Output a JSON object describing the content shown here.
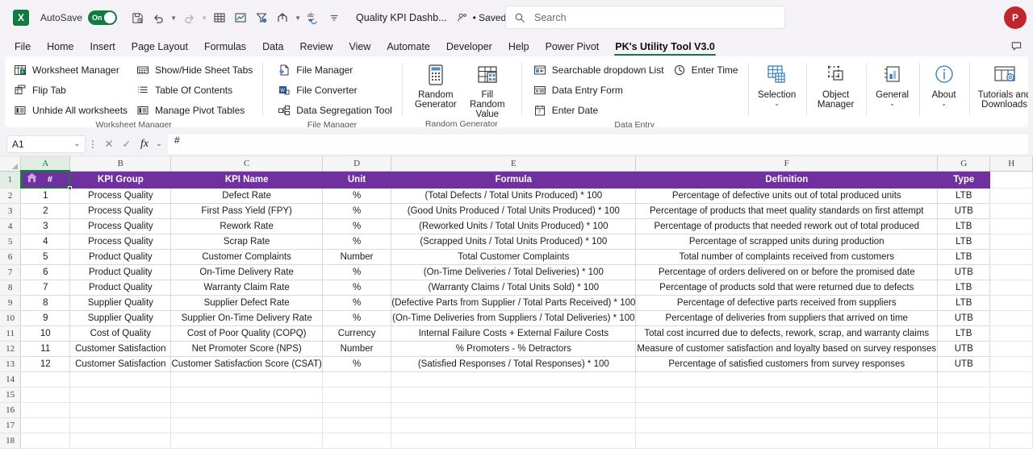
{
  "titlebar": {
    "app_logo_letter": "X",
    "autosave_label": "AutoSave",
    "autosave_state": "On",
    "document_title": "Quality KPI Dashb...",
    "saved_state": "• Saved",
    "quick_access_icons": [
      "save-icon",
      "undo-icon",
      "redo-icon",
      "table-icon",
      "chart-icon",
      "filter-icon",
      "share-icon",
      "spelling-icon",
      "customize-qat-icon"
    ],
    "avatar_initial": "P"
  },
  "search": {
    "placeholder": "Search",
    "value": "",
    "icon": "search-icon"
  },
  "tabs": [
    {
      "label": "File",
      "active": false
    },
    {
      "label": "Home",
      "active": false
    },
    {
      "label": "Insert",
      "active": false
    },
    {
      "label": "Page Layout",
      "active": false
    },
    {
      "label": "Formulas",
      "active": false
    },
    {
      "label": "Data",
      "active": false
    },
    {
      "label": "Review",
      "active": false
    },
    {
      "label": "View",
      "active": false
    },
    {
      "label": "Automate",
      "active": false
    },
    {
      "label": "Developer",
      "active": false
    },
    {
      "label": "Help",
      "active": false
    },
    {
      "label": "Power Pivot",
      "active": false
    },
    {
      "label": "PK's Utility Tool V3.0",
      "active": true
    }
  ],
  "ribbon": {
    "groups": [
      {
        "title": "Worksheet Manager",
        "columns": [
          [
            "Worksheet Manager",
            "Flip Tab",
            "Unhide All worksheets"
          ],
          [
            "Show/Hide Sheet Tabs",
            "Table Of Contents",
            "Manage Pivot Tables"
          ]
        ]
      },
      {
        "title": "File Manager",
        "columns": [
          [
            "File Manager",
            "File Converter",
            "Data Segregation Tool"
          ]
        ]
      },
      {
        "title": "Random Generator",
        "big_buttons": [
          {
            "label": "Random Generator",
            "icon": "calculator-icon",
            "caret": false
          },
          {
            "label": "Fill Random Value",
            "icon": "fill-table-icon",
            "caret": false
          }
        ]
      },
      {
        "title": "Data Entry",
        "columns": [
          [
            "Searchable dropdown List",
            "Data Entry Form",
            "Enter Date"
          ],
          [
            "Enter Time"
          ]
        ]
      },
      {
        "title": "",
        "big_buttons": [
          {
            "label": "Selection",
            "icon": "selection-grid-icon",
            "caret": true
          },
          {
            "label": "Object Manager",
            "icon": "object-manager-icon",
            "caret": true
          },
          {
            "label": "General",
            "icon": "general-chart-icon",
            "caret": true
          },
          {
            "label": "About",
            "icon": "info-icon",
            "caret": true
          },
          {
            "label": "Tutorials and Downloads",
            "icon": "tutorials-gear-icon",
            "caret": true
          }
        ]
      }
    ]
  },
  "formula_bar": {
    "name_box": "A1",
    "cancel_icon": "cancel-icon",
    "confirm_icon": "confirm-icon",
    "fx_label": "fx",
    "content": "#"
  },
  "grid": {
    "column_letters": [
      "A",
      "B",
      "C",
      "D",
      "E",
      "F",
      "G",
      "H"
    ],
    "selected_column": "A",
    "selected_row": 1,
    "row_numbers": [
      1,
      2,
      3,
      4,
      5,
      6,
      7,
      8,
      9,
      10,
      11,
      12,
      13,
      14,
      15,
      16,
      17,
      18
    ],
    "a1_icon": "home-icon",
    "a1_text": "#",
    "header_fill": "#7030A0",
    "headers": [
      "#",
      "KPI Group",
      "KPI Name",
      "Unit",
      "Formula",
      "Definition",
      "Type"
    ],
    "rows": [
      {
        "num": "1",
        "group": "Process Quality",
        "name": "Defect Rate",
        "unit": "%",
        "formula": "(Total Defects / Total Units Produced) * 100",
        "definition": "Percentage of defective units out of total produced units",
        "type": "LTB"
      },
      {
        "num": "2",
        "group": "Process Quality",
        "name": "First Pass Yield (FPY)",
        "unit": "%",
        "formula": "(Good Units Produced / Total Units Produced) * 100",
        "definition": "Percentage of products that meet quality standards on first attempt",
        "type": "UTB"
      },
      {
        "num": "3",
        "group": "Process Quality",
        "name": "Rework Rate",
        "unit": "%",
        "formula": "(Reworked Units / Total Units Produced) * 100",
        "definition": "Percentage of products that needed rework out of total produced",
        "type": "LTB"
      },
      {
        "num": "4",
        "group": "Process Quality",
        "name": "Scrap Rate",
        "unit": "%",
        "formula": "(Scrapped Units / Total Units Produced) * 100",
        "definition": "Percentage of scrapped units during production",
        "type": "LTB"
      },
      {
        "num": "5",
        "group": "Product Quality",
        "name": "Customer Complaints",
        "unit": "Number",
        "formula": "Total Customer Complaints",
        "definition": "Total number of complaints received from customers",
        "type": "LTB"
      },
      {
        "num": "6",
        "group": "Product Quality",
        "name": "On-Time Delivery Rate",
        "unit": "%",
        "formula": "(On-Time Deliveries / Total Deliveries) * 100",
        "definition": "Percentage of orders delivered on or before the promised date",
        "type": "UTB"
      },
      {
        "num": "7",
        "group": "Product Quality",
        "name": "Warranty Claim Rate",
        "unit": "%",
        "formula": "(Warranty Claims / Total Units Sold) * 100",
        "definition": "Percentage of products sold that were returned due to defects",
        "type": "LTB"
      },
      {
        "num": "8",
        "group": "Supplier Quality",
        "name": "Supplier Defect Rate",
        "unit": "%",
        "formula": "(Defective Parts from Supplier / Total Parts Received) * 100",
        "definition": "Percentage of defective parts received from suppliers",
        "type": "LTB"
      },
      {
        "num": "9",
        "group": "Supplier Quality",
        "name": "Supplier On-Time Delivery Rate",
        "unit": "%",
        "formula": "(On-Time Deliveries from Suppliers / Total Deliveries) * 100",
        "definition": "Percentage of deliveries from suppliers that arrived on time",
        "type": "UTB"
      },
      {
        "num": "10",
        "group": "Cost of Quality",
        "name": "Cost of Poor Quality (COPQ)",
        "unit": "Currency",
        "formula": "Internal Failure Costs + External Failure Costs",
        "definition": "Total cost incurred due to defects, rework, scrap, and warranty claims",
        "type": "LTB"
      },
      {
        "num": "11",
        "group": "Customer Satisfaction",
        "name": "Net Promoter Score (NPS)",
        "unit": "Number",
        "formula": "% Promoters - % Detractors",
        "definition": "Measure of customer satisfaction and loyalty based on survey responses",
        "type": "UTB"
      },
      {
        "num": "12",
        "group": "Customer Satisfaction",
        "name": "Customer Satisfaction Score (CSAT)",
        "unit": "%",
        "formula": "(Satisfied Responses / Total Responses) * 100",
        "definition": "Percentage of satisfied customers from survey responses",
        "type": "UTB"
      }
    ]
  }
}
